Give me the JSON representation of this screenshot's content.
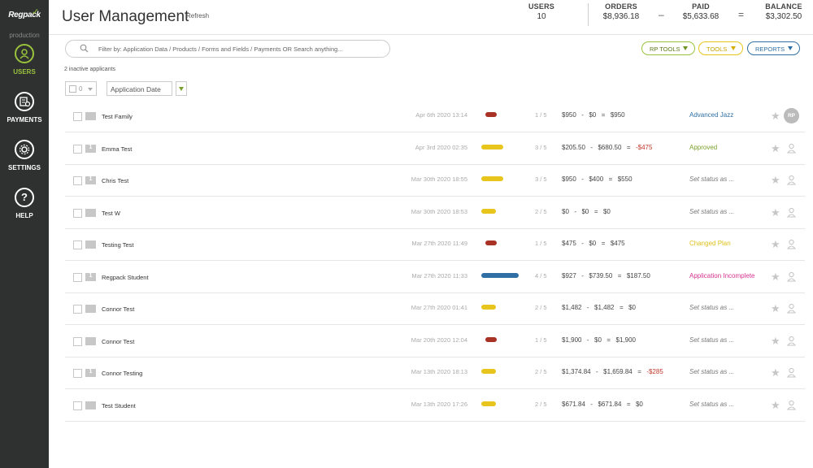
{
  "sidebar": {
    "logo_text": "Regpack",
    "environment": "production",
    "items": [
      {
        "label": "USERS",
        "icon": "user-icon",
        "active": true
      },
      {
        "label": "PAYMENTS",
        "icon": "payments-icon",
        "active": false
      },
      {
        "label": "SETTINGS",
        "icon": "gear-icon",
        "active": false
      },
      {
        "label": "HELP",
        "icon": "help-icon",
        "active": false
      }
    ]
  },
  "header": {
    "title": "User Management",
    "refresh": "Refresh",
    "stats": {
      "users_label": "USERS",
      "users_value": "10",
      "orders_label": "ORDERS",
      "orders_value": "$8,936.18",
      "minus": "–",
      "paid_label": "PAID",
      "paid_value": "$5,633.68",
      "equals": "=",
      "balance_label": "BALANCE",
      "balance_value": "$3,302.50"
    }
  },
  "toolbar": {
    "search_placeholder": "Filter by: Application Data / Products / Forms and Fields / Payments OR Search anything...",
    "rp_tools": "RP TOOLS",
    "tools": "TOOLS",
    "reports": "REPORTS"
  },
  "inactive_text": "2 inactive applicants",
  "selection": {
    "count": "0"
  },
  "sort": {
    "label": "Application Date"
  },
  "colors": {
    "red": "#a93226",
    "yellow": "#e8c51c",
    "blue": "#2f6fa3",
    "accent": "#9ac33c"
  },
  "rows": [
    {
      "name": "Test Family",
      "date": "Apr 6th 2020 13:14",
      "bar": "red",
      "progress": 1,
      "frac": "1 / 5",
      "orders": "$950",
      "paid": "$0",
      "balance": "$950",
      "balance_negative": false,
      "status": "Advanced Jazz",
      "status_color": "#2f6fa3",
      "status_italic": false,
      "badge": "RP"
    },
    {
      "name": "Emma Test",
      "date": "Apr 3rd 2020 02:35",
      "bar": "yellow",
      "progress": 3,
      "frac": "3 / 5",
      "orders": "$205.50",
      "paid": "$680.50",
      "balance": "-$475",
      "balance_negative": true,
      "status": "Approved",
      "status_color": "#7aa02c",
      "status_italic": false,
      "badge": "1"
    },
    {
      "name": "Chris Test",
      "date": "Mar 30th 2020 18:55",
      "bar": "yellow",
      "progress": 3,
      "frac": "3 / 5",
      "orders": "$950",
      "paid": "$400",
      "balance": "$550",
      "balance_negative": false,
      "status": "Set status as ...",
      "status_color": "#777777",
      "status_italic": true,
      "badge": "1"
    },
    {
      "name": "Test W",
      "date": "Mar 30th 2020 18:53",
      "bar": "yellow",
      "progress": 2,
      "frac": "2 / 5",
      "orders": "$0",
      "paid": "$0",
      "balance": "$0",
      "balance_negative": false,
      "status": "Set status as ...",
      "status_color": "#777777",
      "status_italic": true,
      "badge": ""
    },
    {
      "name": "Testing Test",
      "date": "Mar 27th 2020 11:49",
      "bar": "red",
      "progress": 1,
      "frac": "1 / 5",
      "orders": "$475",
      "paid": "$0",
      "balance": "$475",
      "balance_negative": false,
      "status": "Changed Plan",
      "status_color": "#e0c21a",
      "status_italic": false,
      "badge": ""
    },
    {
      "name": "Regpack Student",
      "date": "Mar 27th 2020 11:33",
      "bar": "blue",
      "progress": 4,
      "frac": "4 / 5",
      "orders": "$927",
      "paid": "$739.50",
      "balance": "$187.50",
      "balance_negative": false,
      "status": "Application Incomplete",
      "status_color": "#d6338f",
      "status_italic": false,
      "badge": "1"
    },
    {
      "name": "Connor Test",
      "date": "Mar 27th 2020 01:41",
      "bar": "yellow",
      "progress": 2,
      "frac": "2 / 5",
      "orders": "$1,482",
      "paid": "$1,482",
      "balance": "$0",
      "balance_negative": false,
      "status": "Set status as ...",
      "status_color": "#777777",
      "status_italic": true,
      "badge": ""
    },
    {
      "name": "Connor Test",
      "date": "Mar 20th 2020 12:04",
      "bar": "red",
      "progress": 1,
      "frac": "1 / 5",
      "orders": "$1,900",
      "paid": "$0",
      "balance": "$1,900",
      "balance_negative": false,
      "status": "Set status as ...",
      "status_color": "#777777",
      "status_italic": true,
      "badge": ""
    },
    {
      "name": "Connor Testing",
      "date": "Mar 13th 2020 18:13",
      "bar": "yellow",
      "progress": 2,
      "frac": "2 / 5",
      "orders": "$1,374.84",
      "paid": "$1,659.84",
      "balance": "-$285",
      "balance_negative": true,
      "status": "Set status as ...",
      "status_color": "#777777",
      "status_italic": true,
      "badge": "1"
    },
    {
      "name": "Test Student",
      "date": "Mar 13th 2020 17:26",
      "bar": "yellow",
      "progress": 2,
      "frac": "2 / 5",
      "orders": "$671.84",
      "paid": "$671.84",
      "balance": "$0",
      "balance_negative": false,
      "status": "Set status as ...",
      "status_color": "#777777",
      "status_italic": true,
      "badge": ""
    }
  ]
}
